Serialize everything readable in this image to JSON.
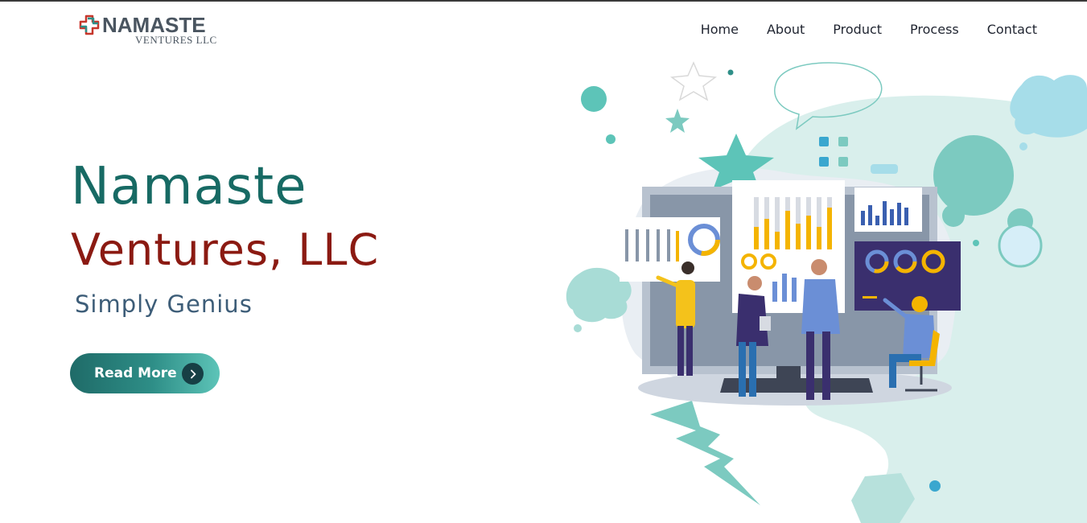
{
  "brand": {
    "name": "NAMASTE",
    "sub": "VENTURES LLC",
    "colors": {
      "red": "#c6372c",
      "teal": "#2f8f88",
      "gray": "#4a5560"
    }
  },
  "nav": {
    "items": [
      {
        "label": "Home"
      },
      {
        "label": "About"
      },
      {
        "label": "Product"
      },
      {
        "label": "Process"
      },
      {
        "label": "Contact"
      }
    ]
  },
  "hero": {
    "title_line1": "Namaste",
    "title_line2": "Ventures, LLC",
    "tagline": "Simply Genius",
    "cta_label": "Read More",
    "cta_icon": "chevron-right-icon",
    "colors": {
      "title1": "#176a64",
      "title2": "#8b1a12",
      "tagline": "#3d5d78"
    }
  },
  "illustration": {
    "icon": "business-analytics-team-illustration",
    "accent_colors": [
      "#5dc4b8",
      "#f4b400",
      "#3a2f6e",
      "#6b8fd6"
    ]
  }
}
